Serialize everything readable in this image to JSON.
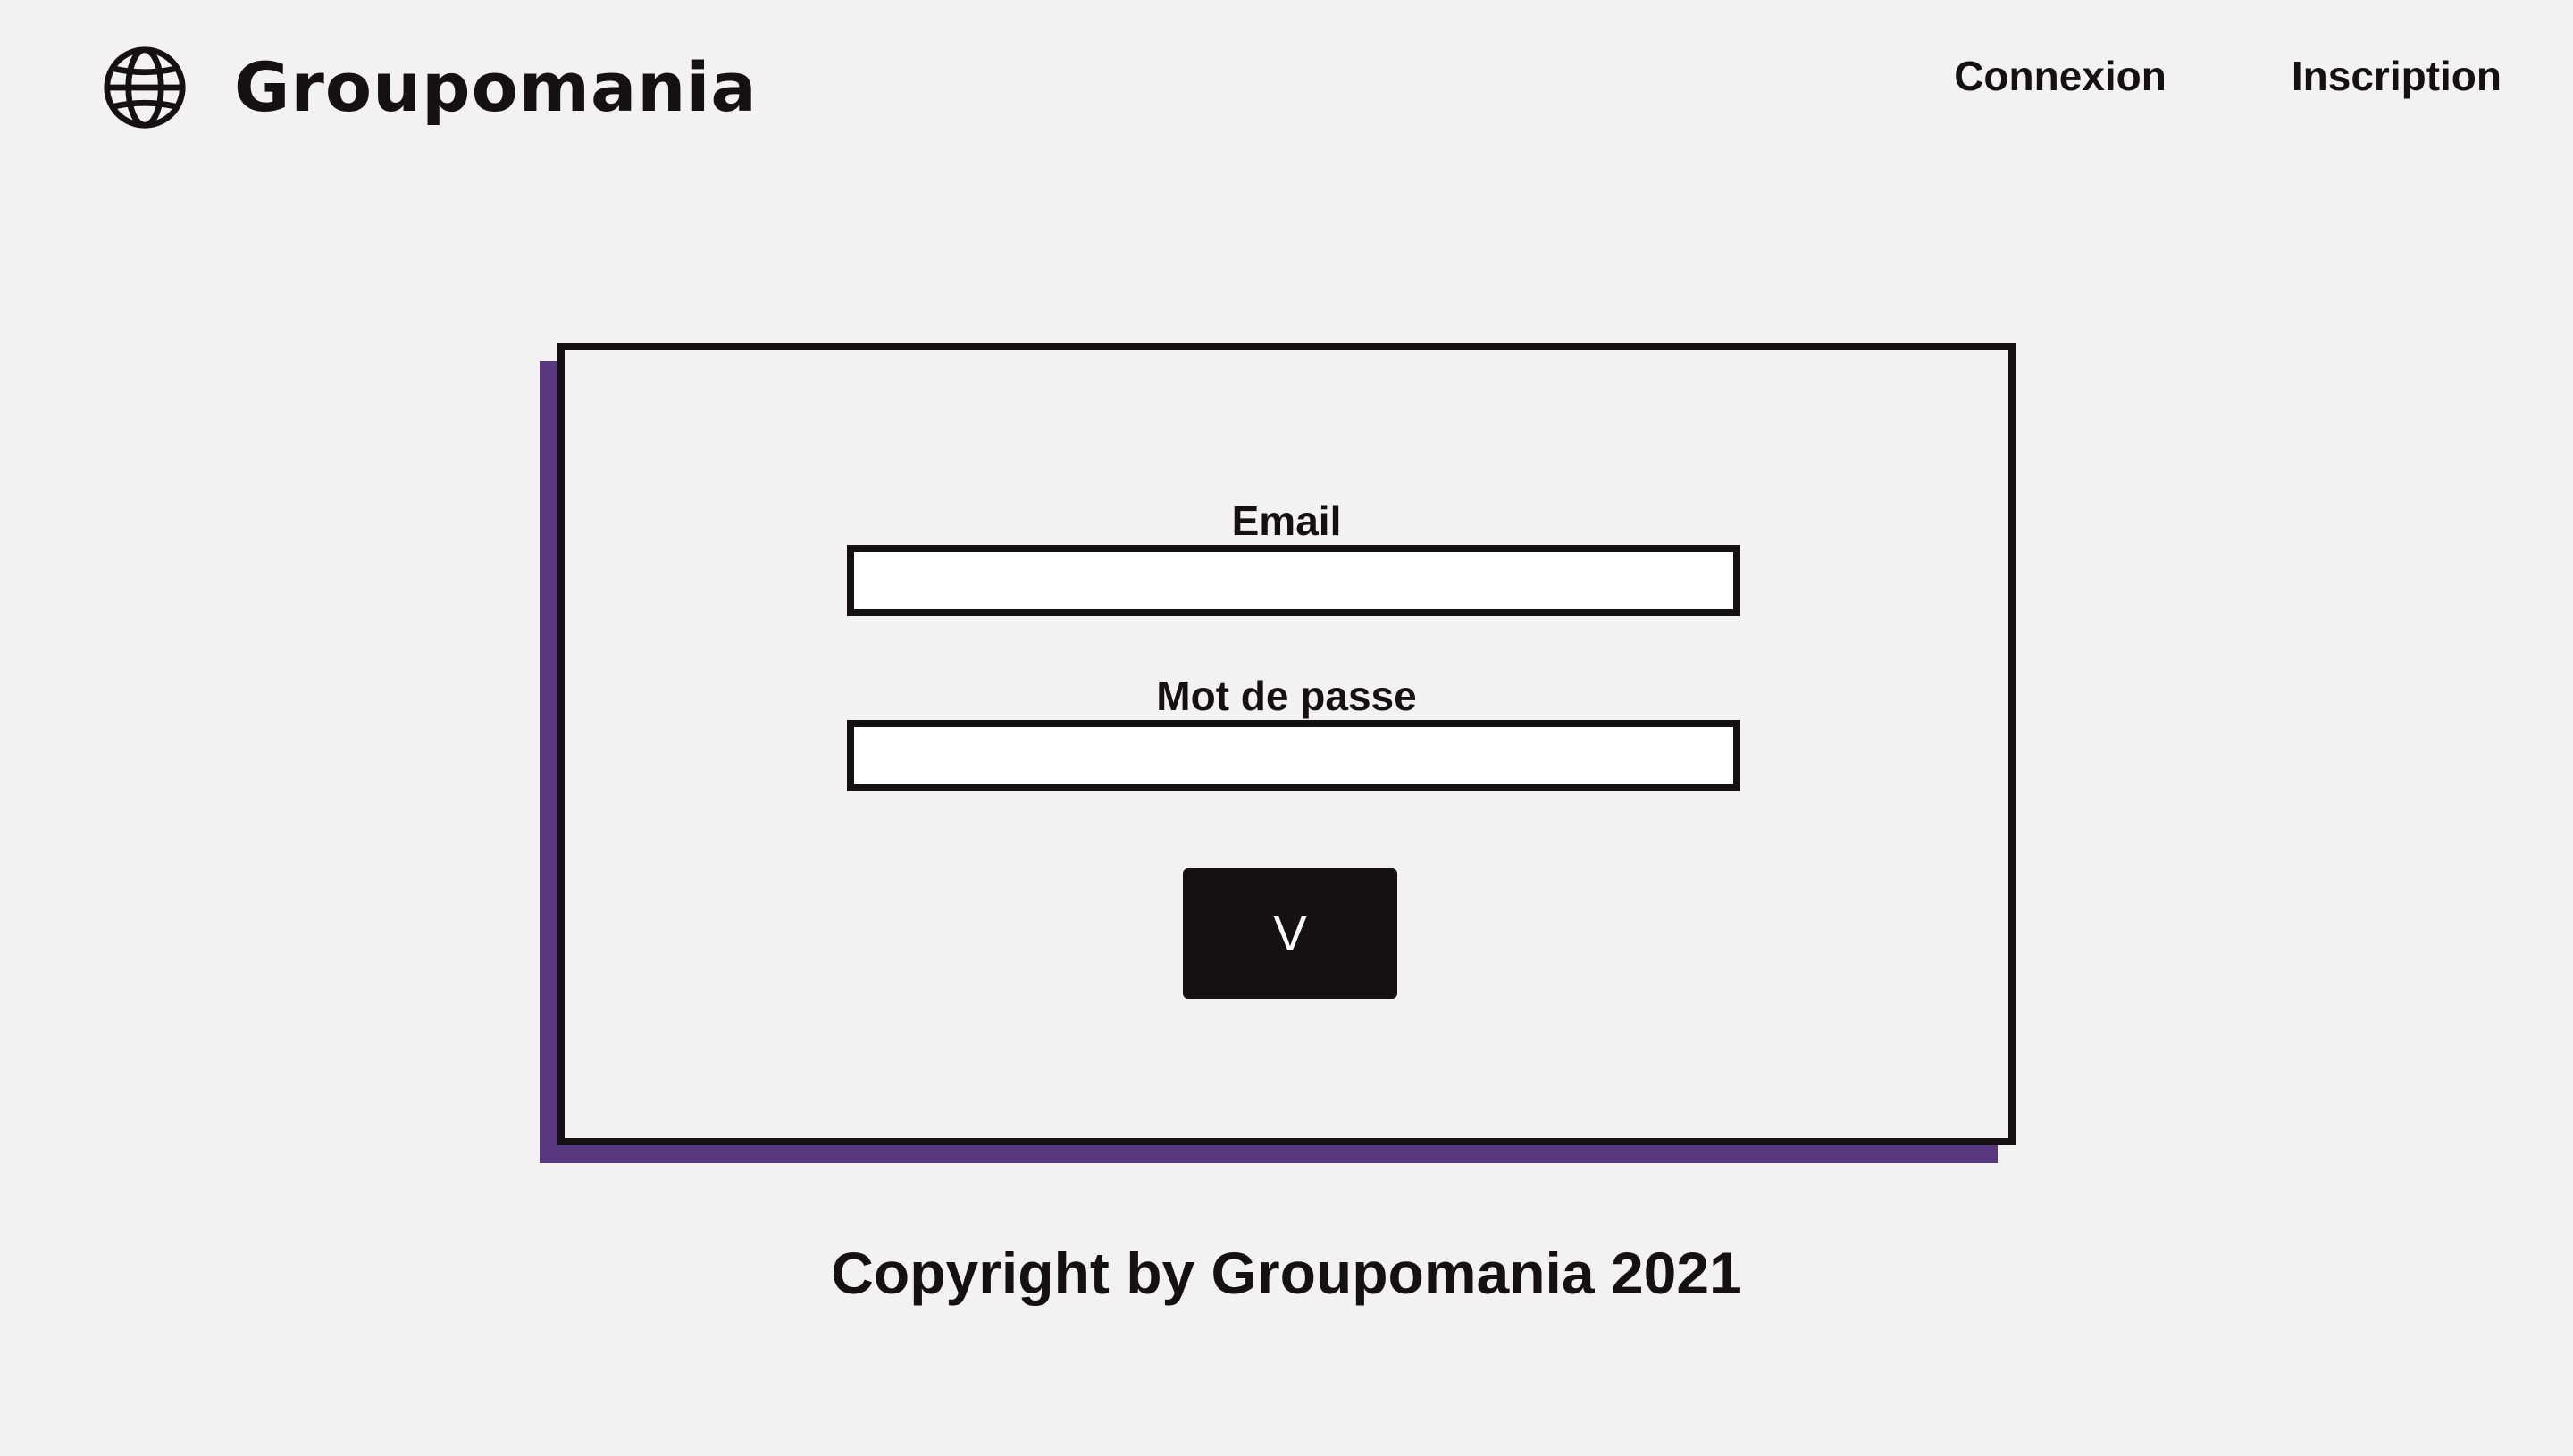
{
  "header": {
    "brand_name": "Groupomania",
    "logo_icon": "globe-icon",
    "nav": [
      {
        "label": "Connexion"
      },
      {
        "label": "Inscription"
      }
    ]
  },
  "login_form": {
    "email_label": "Email",
    "email_value": "",
    "password_label": "Mot de passe",
    "password_value": "",
    "submit_label": "V"
  },
  "footer": {
    "copyright": "Copyright by Groupomania 2021"
  },
  "colors": {
    "background": "#f2f2f2",
    "text": "#141112",
    "accent_shadow": "#58387f",
    "button_bg": "#141112",
    "input_bg": "#ffffff"
  }
}
